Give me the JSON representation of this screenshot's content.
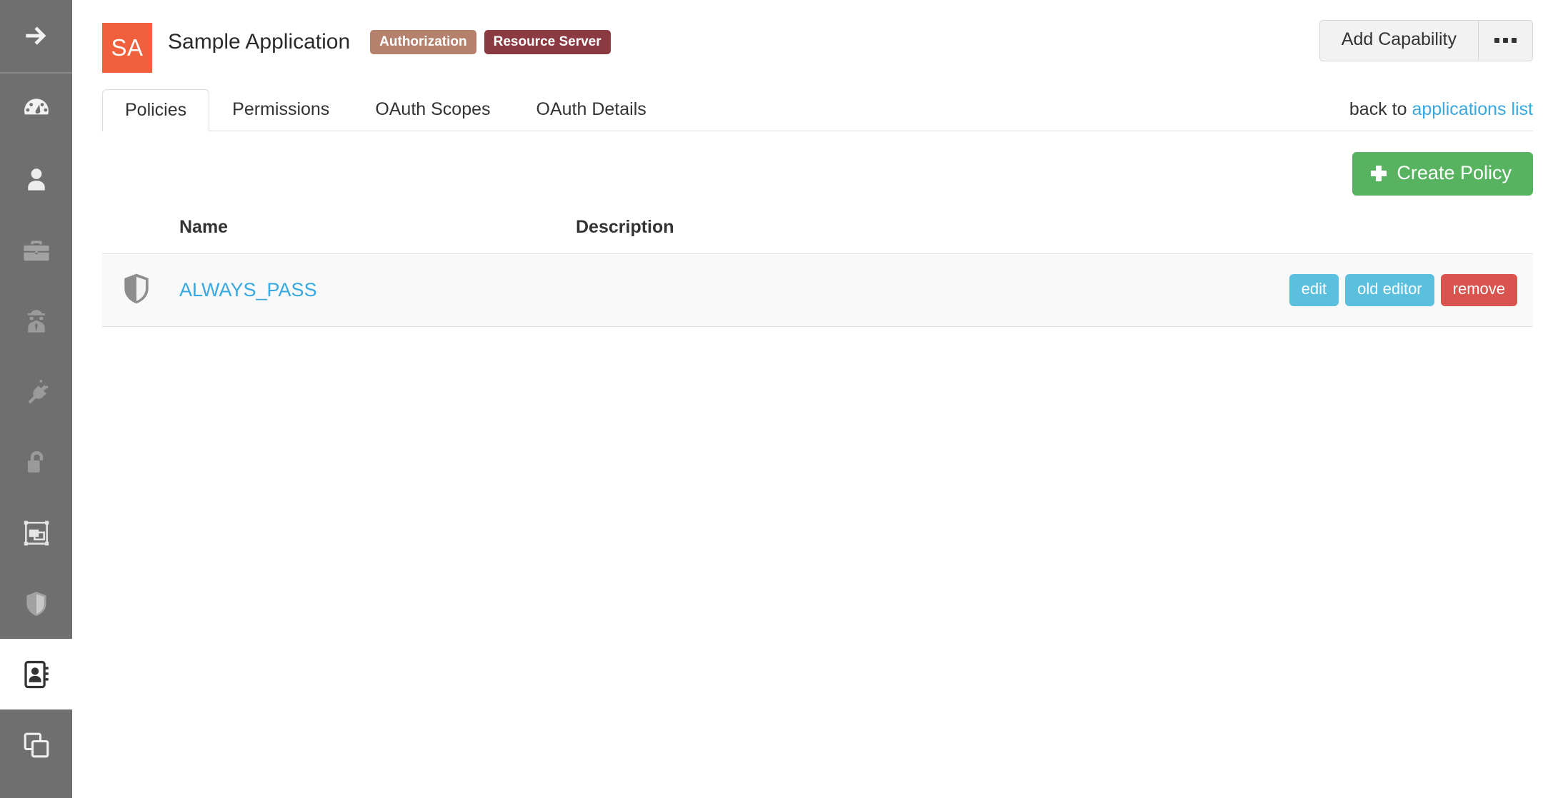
{
  "sidebar": {
    "items": [
      {
        "name": "expand-nav",
        "icon": "arrow-right-icon",
        "active": false
      },
      {
        "name": "dashboard",
        "icon": "gauge-icon",
        "active": false
      },
      {
        "name": "users",
        "icon": "user-icon",
        "active": false
      },
      {
        "name": "business",
        "icon": "briefcase-icon",
        "active": false
      },
      {
        "name": "agents",
        "icon": "spy-icon",
        "active": false
      },
      {
        "name": "integrations",
        "icon": "plug-icon",
        "active": false
      },
      {
        "name": "authentication",
        "icon": "unlock-icon",
        "active": false
      },
      {
        "name": "transform",
        "icon": "transform-icon",
        "active": false
      },
      {
        "name": "policies",
        "icon": "shield-icon",
        "active": false
      },
      {
        "name": "applications",
        "icon": "address-book-icon",
        "active": true
      },
      {
        "name": "copies",
        "icon": "copy-icon",
        "active": false
      }
    ]
  },
  "header": {
    "avatar_initials": "SA",
    "title": "Sample Application",
    "badges": [
      {
        "label": "Authorization",
        "color": "#b5806c"
      },
      {
        "label": "Resource Server",
        "color": "#8c3a42"
      }
    ],
    "add_capability_label": "Add Capability",
    "overflow_label": "•••"
  },
  "tabs": [
    {
      "label": "Policies",
      "active": true
    },
    {
      "label": "Permissions",
      "active": false
    },
    {
      "label": "OAuth Scopes",
      "active": false
    },
    {
      "label": "OAuth Details",
      "active": false
    }
  ],
  "back": {
    "prefix": "back to ",
    "link_label": "applications list"
  },
  "toolbar": {
    "create_policy_label": "Create Policy"
  },
  "table": {
    "columns": [
      "Name",
      "Description"
    ],
    "rows": [
      {
        "icon": "shield-icon",
        "name": "ALWAYS_PASS",
        "description": "",
        "actions": [
          {
            "label": "edit",
            "style": "blue"
          },
          {
            "label": "old editor",
            "style": "blue"
          },
          {
            "label": "remove",
            "style": "red"
          }
        ]
      }
    ]
  },
  "colors": {
    "sidebar_bg": "#706f6f",
    "avatar_bg": "#f0603c",
    "link_blue": "#38a8e0",
    "create_green": "#57b360",
    "btn_blue": "#5bc0de",
    "btn_red": "#d9534f"
  }
}
